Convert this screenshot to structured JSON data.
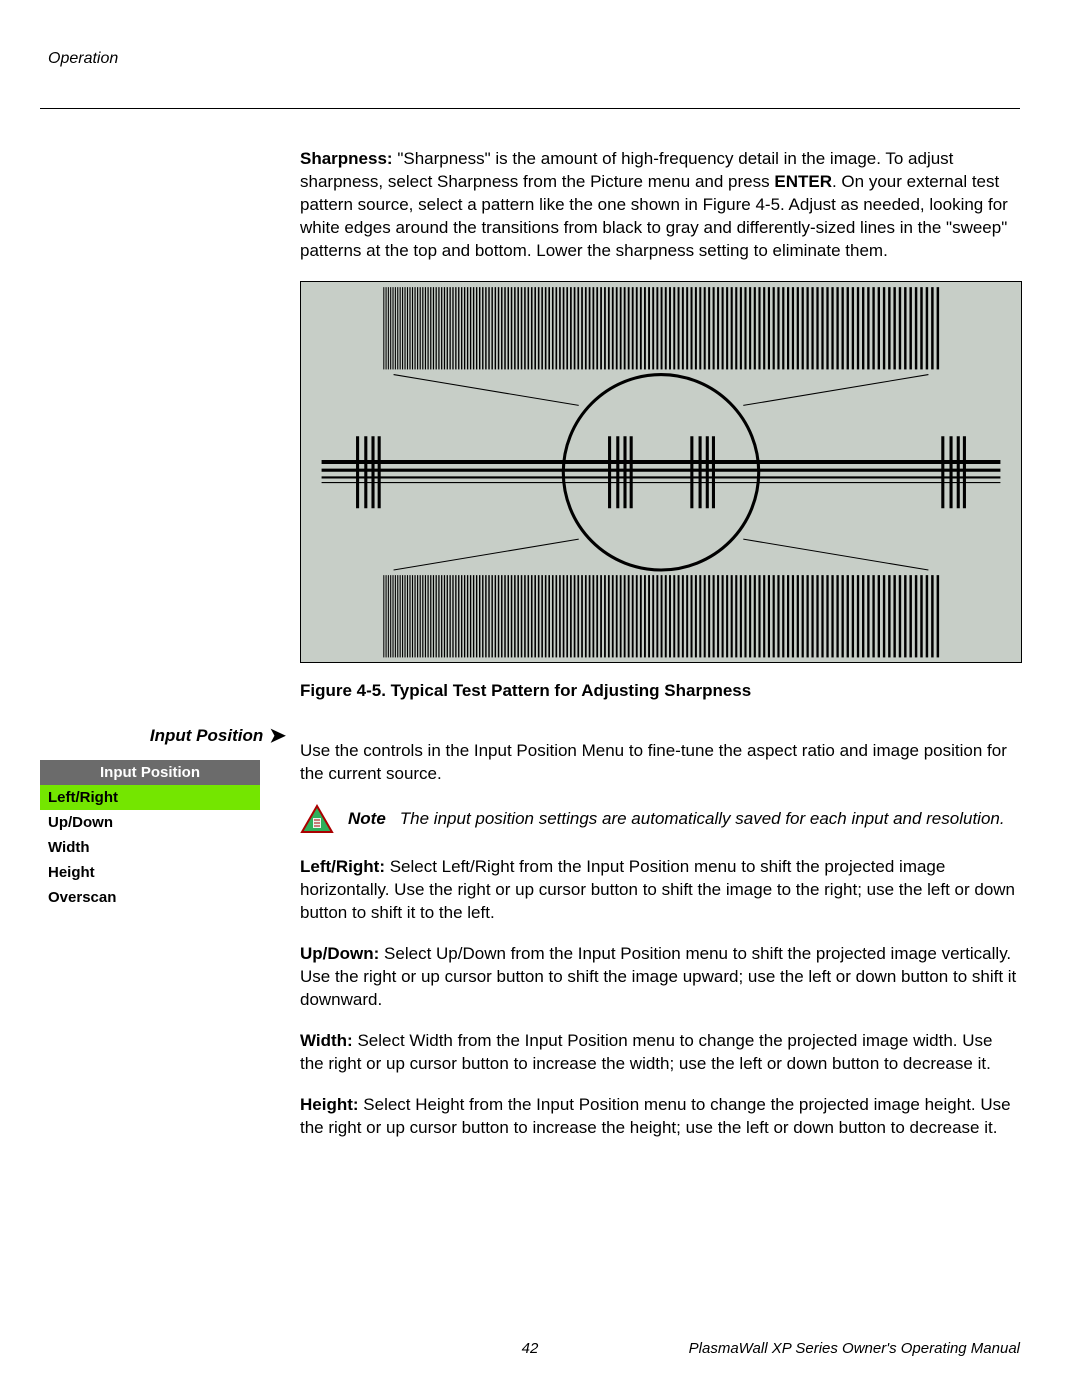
{
  "header": {
    "section": "Operation"
  },
  "sharpness": {
    "label": "Sharpness:",
    "text_a": " \"Sharpness\" is the amount of high-frequency detail in the image. To adjust sharpness, select Sharpness from the Picture menu and press ",
    "enter": "ENTER",
    "text_b": ". On your external test pattern source, select a pattern like the one shown in Figure 4-5. Adjust as needed, looking for white edges around the transitions from black to gray and differently-sized lines in the \"sweep\" patterns at the top and bottom. Lower the sharpness setting to eliminate them."
  },
  "figure": {
    "caption": "Figure 4-5. Typical Test Pattern for Adjusting Sharpness"
  },
  "input_position": {
    "heading": "Input Position",
    "intro": "Use the controls in the Input Position Menu to fine-tune the aspect ratio and image position for the current source.",
    "menu_title": "Input Position",
    "menu_items": [
      "Left/Right",
      "Up/Down",
      "Width",
      "Height",
      "Overscan"
    ],
    "note_word": "Note",
    "note_body": "The input position settings are automatically saved for each input and resolution.",
    "lr_label": "Left/Right:",
    "lr_text": " Select Left/Right from the Input Position menu to shift the projected image horizontally. Use the right or up cursor button to shift the image to the right; use the left or down button to shift it to the left.",
    "ud_label": "Up/Down:",
    "ud_text": " Select Up/Down from the Input Position menu to shift the projected image vertically. Use the right or up cursor button to shift the image upward; use the left or down button to shift it downward.",
    "w_label": "Width:",
    "w_text": " Select Width from the Input Position menu to change the projected image width. Use the right or up cursor button to increase the width; use the left or down button to decrease it.",
    "h_label": "Height:",
    "h_text": " Select Height from the Input Position menu to change the projected image height. Use the right or up cursor button to increase the height; use the left or down button to decrease it."
  },
  "footer": {
    "page": "42",
    "manual": "PlasmaWall XP Series Owner's Operating Manual"
  }
}
